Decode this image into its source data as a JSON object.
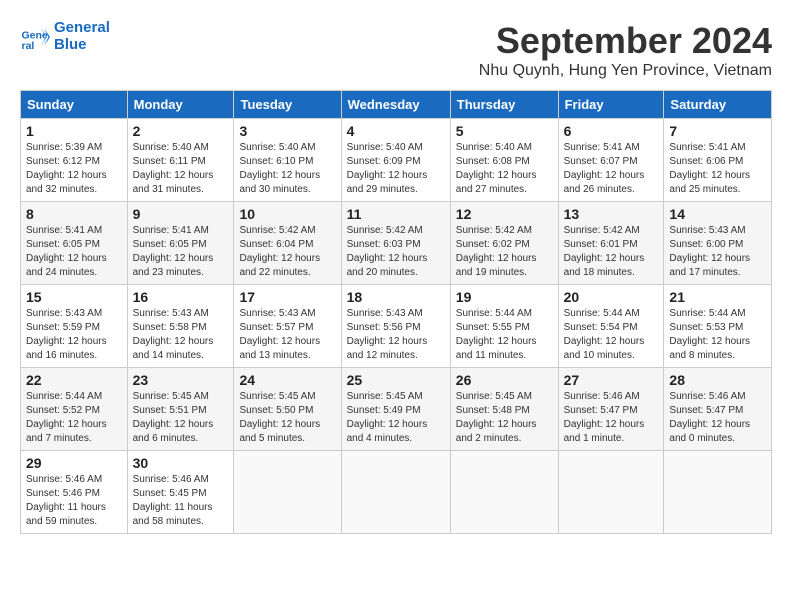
{
  "logo": {
    "line1": "General",
    "line2": "Blue"
  },
  "title": "September 2024",
  "location": "Nhu Quynh, Hung Yen Province, Vietnam",
  "headers": [
    "Sunday",
    "Monday",
    "Tuesday",
    "Wednesday",
    "Thursday",
    "Friday",
    "Saturday"
  ],
  "weeks": [
    [
      {
        "day": "1",
        "info": "Sunrise: 5:39 AM\nSunset: 6:12 PM\nDaylight: 12 hours\nand 32 minutes."
      },
      {
        "day": "2",
        "info": "Sunrise: 5:40 AM\nSunset: 6:11 PM\nDaylight: 12 hours\nand 31 minutes."
      },
      {
        "day": "3",
        "info": "Sunrise: 5:40 AM\nSunset: 6:10 PM\nDaylight: 12 hours\nand 30 minutes."
      },
      {
        "day": "4",
        "info": "Sunrise: 5:40 AM\nSunset: 6:09 PM\nDaylight: 12 hours\nand 29 minutes."
      },
      {
        "day": "5",
        "info": "Sunrise: 5:40 AM\nSunset: 6:08 PM\nDaylight: 12 hours\nand 27 minutes."
      },
      {
        "day": "6",
        "info": "Sunrise: 5:41 AM\nSunset: 6:07 PM\nDaylight: 12 hours\nand 26 minutes."
      },
      {
        "day": "7",
        "info": "Sunrise: 5:41 AM\nSunset: 6:06 PM\nDaylight: 12 hours\nand 25 minutes."
      }
    ],
    [
      {
        "day": "8",
        "info": "Sunrise: 5:41 AM\nSunset: 6:05 PM\nDaylight: 12 hours\nand 24 minutes."
      },
      {
        "day": "9",
        "info": "Sunrise: 5:41 AM\nSunset: 6:05 PM\nDaylight: 12 hours\nand 23 minutes."
      },
      {
        "day": "10",
        "info": "Sunrise: 5:42 AM\nSunset: 6:04 PM\nDaylight: 12 hours\nand 22 minutes."
      },
      {
        "day": "11",
        "info": "Sunrise: 5:42 AM\nSunset: 6:03 PM\nDaylight: 12 hours\nand 20 minutes."
      },
      {
        "day": "12",
        "info": "Sunrise: 5:42 AM\nSunset: 6:02 PM\nDaylight: 12 hours\nand 19 minutes."
      },
      {
        "day": "13",
        "info": "Sunrise: 5:42 AM\nSunset: 6:01 PM\nDaylight: 12 hours\nand 18 minutes."
      },
      {
        "day": "14",
        "info": "Sunrise: 5:43 AM\nSunset: 6:00 PM\nDaylight: 12 hours\nand 17 minutes."
      }
    ],
    [
      {
        "day": "15",
        "info": "Sunrise: 5:43 AM\nSunset: 5:59 PM\nDaylight: 12 hours\nand 16 minutes."
      },
      {
        "day": "16",
        "info": "Sunrise: 5:43 AM\nSunset: 5:58 PM\nDaylight: 12 hours\nand 14 minutes."
      },
      {
        "day": "17",
        "info": "Sunrise: 5:43 AM\nSunset: 5:57 PM\nDaylight: 12 hours\nand 13 minutes."
      },
      {
        "day": "18",
        "info": "Sunrise: 5:43 AM\nSunset: 5:56 PM\nDaylight: 12 hours\nand 12 minutes."
      },
      {
        "day": "19",
        "info": "Sunrise: 5:44 AM\nSunset: 5:55 PM\nDaylight: 12 hours\nand 11 minutes."
      },
      {
        "day": "20",
        "info": "Sunrise: 5:44 AM\nSunset: 5:54 PM\nDaylight: 12 hours\nand 10 minutes."
      },
      {
        "day": "21",
        "info": "Sunrise: 5:44 AM\nSunset: 5:53 PM\nDaylight: 12 hours\nand 8 minutes."
      }
    ],
    [
      {
        "day": "22",
        "info": "Sunrise: 5:44 AM\nSunset: 5:52 PM\nDaylight: 12 hours\nand 7 minutes."
      },
      {
        "day": "23",
        "info": "Sunrise: 5:45 AM\nSunset: 5:51 PM\nDaylight: 12 hours\nand 6 minutes."
      },
      {
        "day": "24",
        "info": "Sunrise: 5:45 AM\nSunset: 5:50 PM\nDaylight: 12 hours\nand 5 minutes."
      },
      {
        "day": "25",
        "info": "Sunrise: 5:45 AM\nSunset: 5:49 PM\nDaylight: 12 hours\nand 4 minutes."
      },
      {
        "day": "26",
        "info": "Sunrise: 5:45 AM\nSunset: 5:48 PM\nDaylight: 12 hours\nand 2 minutes."
      },
      {
        "day": "27",
        "info": "Sunrise: 5:46 AM\nSunset: 5:47 PM\nDaylight: 12 hours\nand 1 minute."
      },
      {
        "day": "28",
        "info": "Sunrise: 5:46 AM\nSunset: 5:47 PM\nDaylight: 12 hours\nand 0 minutes."
      }
    ],
    [
      {
        "day": "29",
        "info": "Sunrise: 5:46 AM\nSunset: 5:46 PM\nDaylight: 11 hours\nand 59 minutes."
      },
      {
        "day": "30",
        "info": "Sunrise: 5:46 AM\nSunset: 5:45 PM\nDaylight: 11 hours\nand 58 minutes."
      },
      null,
      null,
      null,
      null,
      null
    ]
  ]
}
